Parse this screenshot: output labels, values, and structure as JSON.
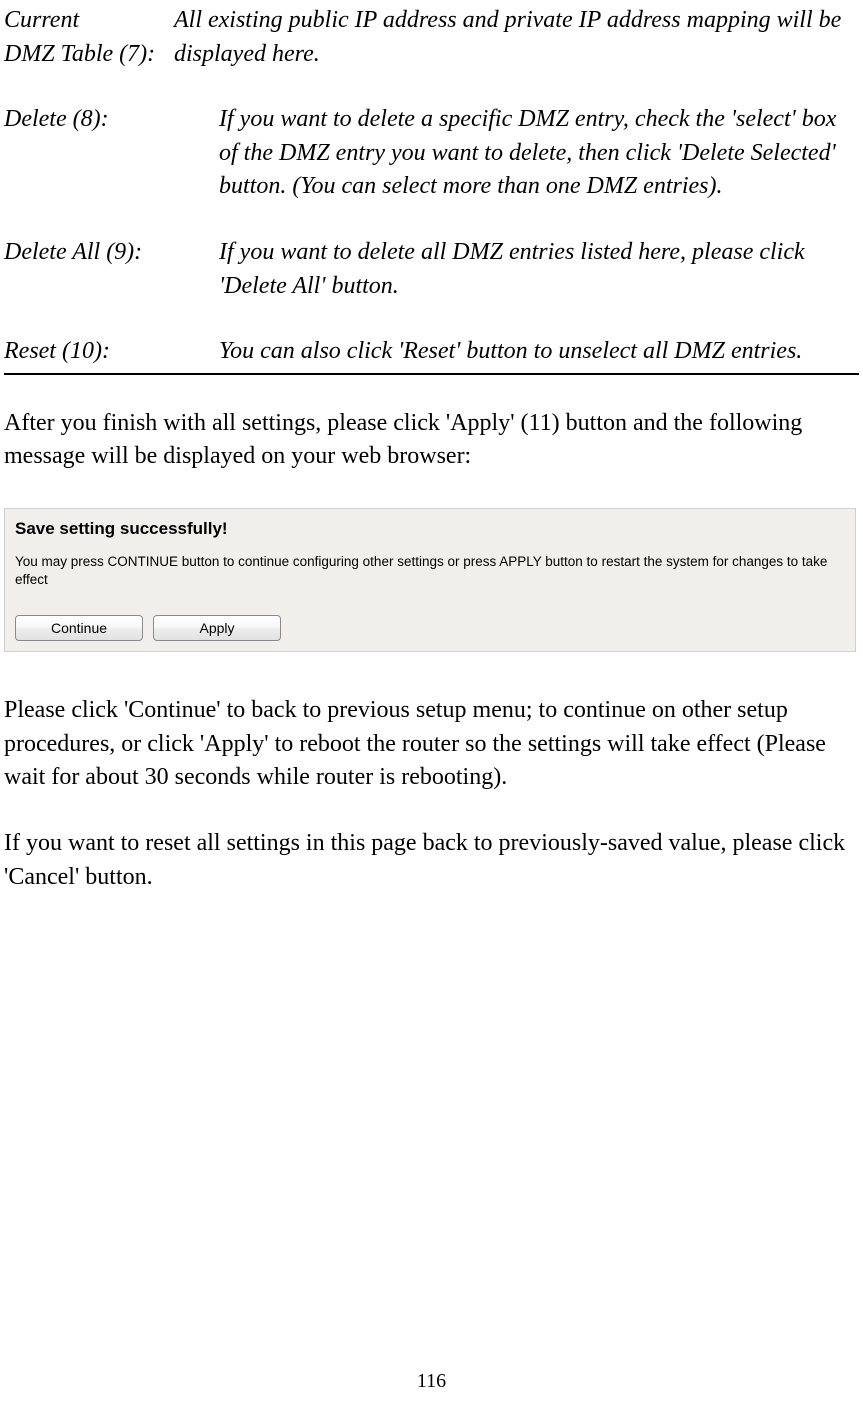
{
  "definitions": [
    {
      "label_line1": "Current",
      "label_line2": "DMZ Table (7):",
      "desc": "All existing public IP address and private IP address mapping will be displayed here."
    },
    {
      "label": "Delete (8):",
      "desc": "If you want to delete a specific DMZ entry, check the 'select' box of the DMZ entry you want to delete, then click 'Delete Selected' button. (You can select more than one DMZ entries)."
    },
    {
      "label": "Delete All (9):",
      "desc": "If you want to delete all DMZ entries listed here, please click 'Delete All' button."
    },
    {
      "label": "Reset (10):",
      "desc": "You can also click 'Reset' button to unselect all DMZ entries."
    }
  ],
  "body1": "After you finish with all settings, please click 'Apply' (11) button and the following message will be displayed on your web browser:",
  "dialog": {
    "title": "Save setting successfully!",
    "msg": "You may press CONTINUE button to continue configuring other settings or press APPLY button to restart the system for changes to take effect",
    "continue_label": "Continue",
    "apply_label": "Apply"
  },
  "body2": "Please click 'Continue' to back to previous setup menu; to continue on other setup procedures, or click 'Apply' to reboot the router so the settings will take effect (Please wait for about 30 seconds while router is rebooting).",
  "body3": "If you want to reset all settings in this page back to previously-saved value, please click 'Cancel' button.",
  "page_number": "116"
}
